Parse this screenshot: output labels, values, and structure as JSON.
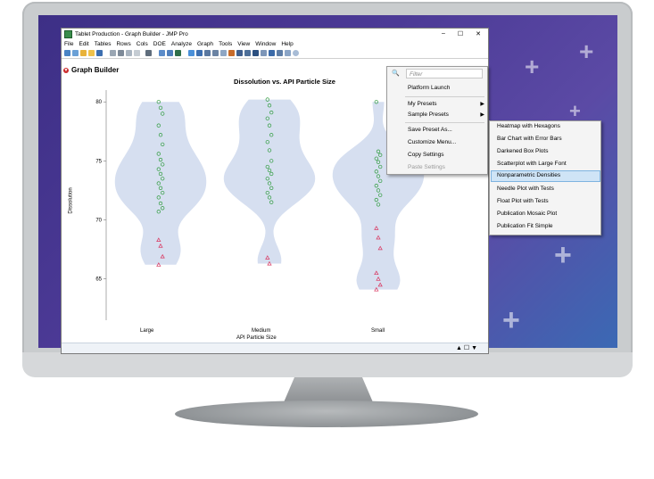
{
  "window": {
    "title": "Tablet Production - Graph Builder - JMP Pro",
    "controls": {
      "minimize": "–",
      "maximize": "☐",
      "close": "✕"
    }
  },
  "menubar": [
    "File",
    "Edit",
    "Tables",
    "Rows",
    "Cols",
    "DOE",
    "Analyze",
    "Graph",
    "Tools",
    "View",
    "Window",
    "Help"
  ],
  "report": {
    "header": "Graph Builder"
  },
  "chart_data": {
    "type": "violin",
    "title": "Dissolution vs. API Particle Size",
    "xlabel": "API Particle Size",
    "ylabel": "Dissolution",
    "categories": [
      "Large",
      "Medium",
      "Small"
    ],
    "ylim": [
      61.5,
      81
    ],
    "yticks": [
      65,
      70,
      75,
      80
    ],
    "grid": false,
    "colors": {
      "violin": "#d6dff0",
      "circle": "#2e9b3d",
      "triangle": "#d9365f"
    },
    "series": [
      {
        "marker": "circle",
        "values": [
          [
            80.0,
            79.5,
            79.0,
            78.0,
            77.2,
            76.4,
            75.6,
            75.1,
            74.7,
            74.3,
            73.9,
            73.5,
            73.1,
            72.7,
            72.3,
            71.9,
            71.4,
            71.0,
            70.7
          ],
          [
            80.2,
            79.7,
            79.1,
            78.6,
            78.0,
            77.2,
            76.6,
            75.9,
            75.0,
            74.5,
            74.2,
            73.9,
            73.5,
            73.1,
            72.7,
            72.3,
            71.9,
            71.5
          ],
          [
            80.0,
            75.8,
            75.5,
            75.2,
            74.9,
            74.5,
            74.1,
            73.7,
            73.3,
            72.9,
            72.5,
            72.1,
            71.7,
            71.3
          ]
        ]
      },
      {
        "marker": "triangle",
        "values": [
          [
            68.3,
            67.8,
            66.9,
            66.2
          ],
          [
            66.8,
            66.3
          ],
          [
            69.3,
            68.5,
            67.6,
            65.5,
            65.0,
            64.5,
            64.1
          ]
        ]
      }
    ]
  },
  "status_icons": [
    "▲",
    "☐",
    "▼"
  ],
  "context_menu": {
    "filter_placeholder": "Filter",
    "items": [
      "Platform Launch",
      "My Presets",
      "Sample Presets",
      "Save Preset As...",
      "Customize Menu...",
      "Copy Settings",
      "Paste Settings"
    ]
  },
  "submenu": {
    "items": [
      "Heatmap with Hexagons",
      "Bar Chart with Error Bars",
      "Darkened Box Plots",
      "Scatterplot with Large Font",
      "Nonparametric Densities",
      "Needle Plot with Tests",
      "Float Plot with Tests",
      "Publication Mosaic Plot",
      "Publication Fit Simple"
    ],
    "selected": "Nonparametric Densities"
  }
}
